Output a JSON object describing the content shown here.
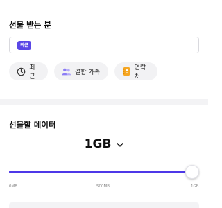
{
  "recipient": {
    "title": "선물 받는 분",
    "chip_label": "최근"
  },
  "quick_chips": [
    {
      "label": "최근",
      "icon": "clock-icon"
    },
    {
      "label": "결합 가족",
      "icon": "family-icon"
    },
    {
      "label": "연락처",
      "icon": "contacts-book-icon"
    }
  ],
  "gift": {
    "title": "선물할 데이터",
    "amount": "1GB",
    "slider": {
      "min_label": "0MB",
      "mid_label": "500MB",
      "max_label": "1GB",
      "value_fraction": 1.0
    }
  },
  "colors": {
    "accent": "#4d38e8",
    "chip_bg": "#f2f2f4",
    "icon_purple": "#8c7df5",
    "icon_orange": "#f5a623"
  }
}
